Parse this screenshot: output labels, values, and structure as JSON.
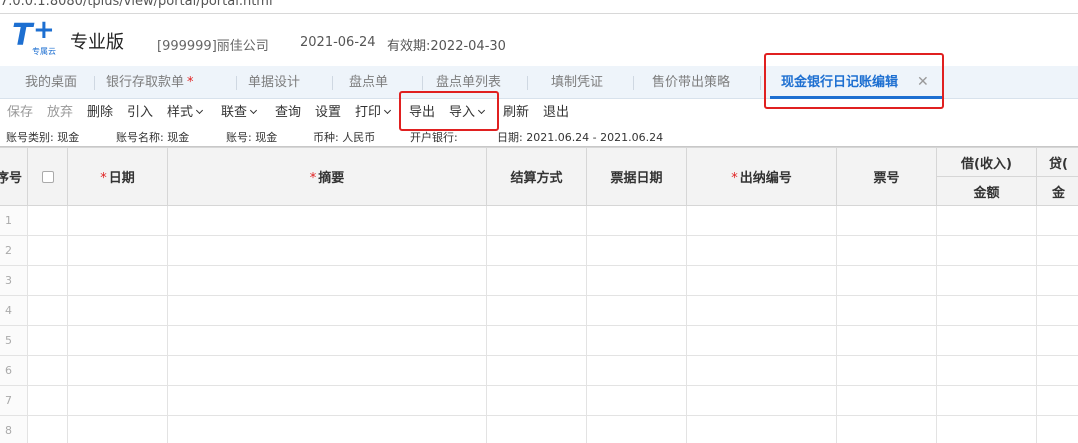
{
  "browser": {
    "url_fragment": "7.0.0.1:8080/tplus/view/portal/portal.html"
  },
  "header": {
    "logo_main": "T",
    "logo_sub": "专属云",
    "edition": "专业版",
    "company": "[999999]丽佳公司",
    "date": "2021-06-24",
    "expiry": "有效期:2022-04-30",
    "brand_color": "#1d6fd1"
  },
  "tabs": [
    {
      "label": "我的桌面"
    },
    {
      "label": "银行存取款单",
      "required_mark": "*"
    },
    {
      "label": "单据设计"
    },
    {
      "label": "盘点单"
    },
    {
      "label": "盘点单列表"
    },
    {
      "label": "填制凭证"
    },
    {
      "label": "售价带出策略"
    },
    {
      "label": "现金银行日记账编辑",
      "active": true,
      "close": "✕"
    }
  ],
  "toolbar": {
    "save": "保存",
    "discard": "放弃",
    "delete": "删除",
    "import_ref": "引入",
    "style": "样式",
    "linked_query": "联查",
    "query": "查询",
    "settings": "设置",
    "print": "打印",
    "export": "导出",
    "import": "导入",
    "refresh": "刷新",
    "exit": "退出"
  },
  "info": {
    "account_type": "账号类别: 现金",
    "account_name": "账号名称: 现金",
    "account_no": "账号: 现金",
    "currency": "币种: 人民币",
    "bank": "开户银行:",
    "date_range": "日期: 2021.06.24 - 2021.06.24"
  },
  "grid": {
    "columns": {
      "seq": "序号",
      "date": "日期",
      "summary": "摘要",
      "settlement": "结算方式",
      "bill_date": "票据日期",
      "cashier_no": "出纳编号",
      "ticket_no": "票号",
      "debit": "借(收入)",
      "debit_amount": "金额",
      "credit": "贷(",
      "credit_amount": "金"
    },
    "required_mark": "*",
    "rows": [
      "1",
      "2",
      "3",
      "4",
      "5",
      "6",
      "7",
      "8"
    ]
  },
  "highlight_color": "#e02020"
}
